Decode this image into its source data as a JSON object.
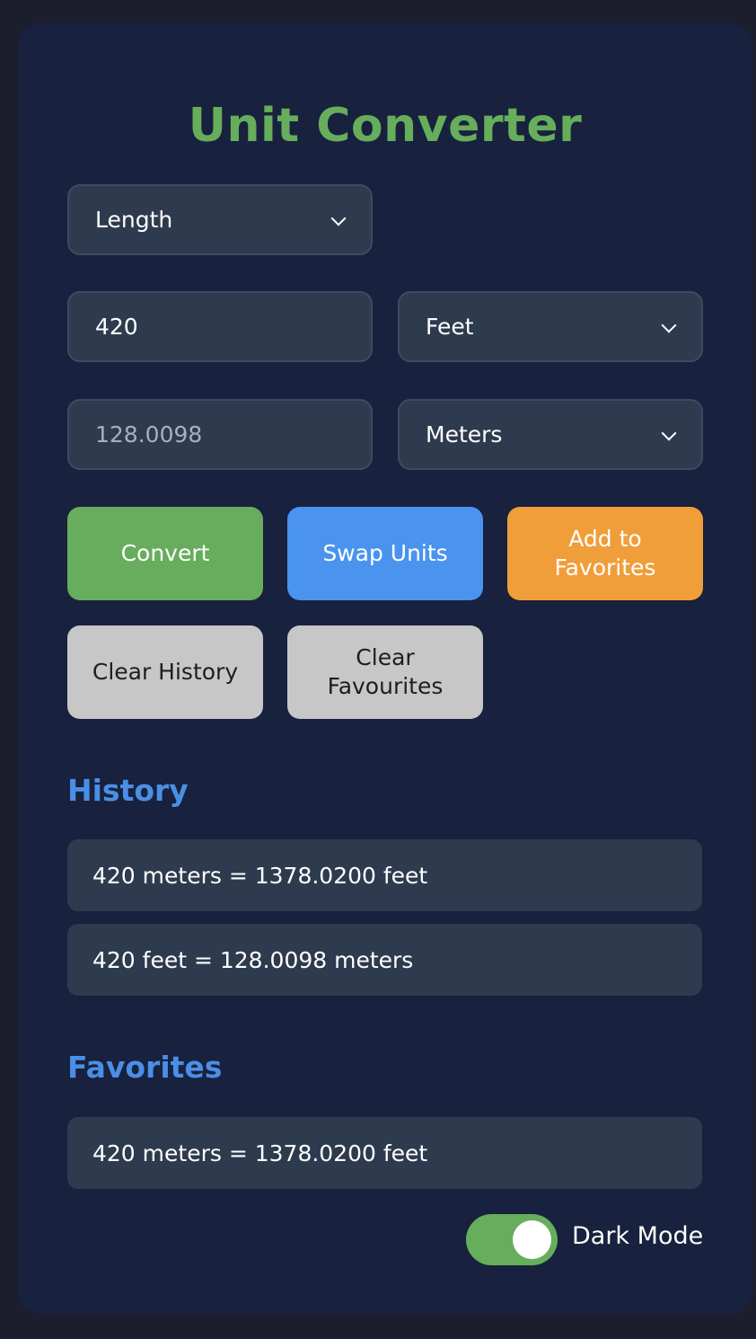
{
  "app": {
    "title": "Unit Converter",
    "colors": {
      "background": "#1c1e2e",
      "card": "#18213d",
      "title": "#66ad5c",
      "section_title": "#4a8ee6",
      "field": "#2e3b4e",
      "convert": "#68ad5d",
      "swap": "#4a93ee",
      "favorite": "#f09e3a",
      "clear": "#c7c7c7",
      "toggle_on": "#66ad5c"
    }
  },
  "converter": {
    "category_select": {
      "value": "Length",
      "icon": "chevron-down-icon"
    },
    "input_value": "420",
    "from_unit_select": {
      "value": "Feet",
      "icon": "chevron-down-icon"
    },
    "output_value": "128.0098",
    "to_unit_select": {
      "value": "Meters",
      "icon": "chevron-down-icon"
    }
  },
  "actions": {
    "convert_label": "Convert",
    "swap_label": "Swap Units",
    "add_favorite_label": "Add to Favorites",
    "clear_history_label": "Clear History",
    "clear_favourites_label": "Clear Favourites"
  },
  "history": {
    "title": "History",
    "items": [
      "420 meters = 1378.0200 feet",
      "420 feet = 128.0098 meters"
    ]
  },
  "favorites": {
    "title": "Favorites",
    "items": [
      "420 meters = 1378.0200 feet"
    ]
  },
  "theme_toggle": {
    "label": "Dark Mode",
    "enabled": true
  }
}
